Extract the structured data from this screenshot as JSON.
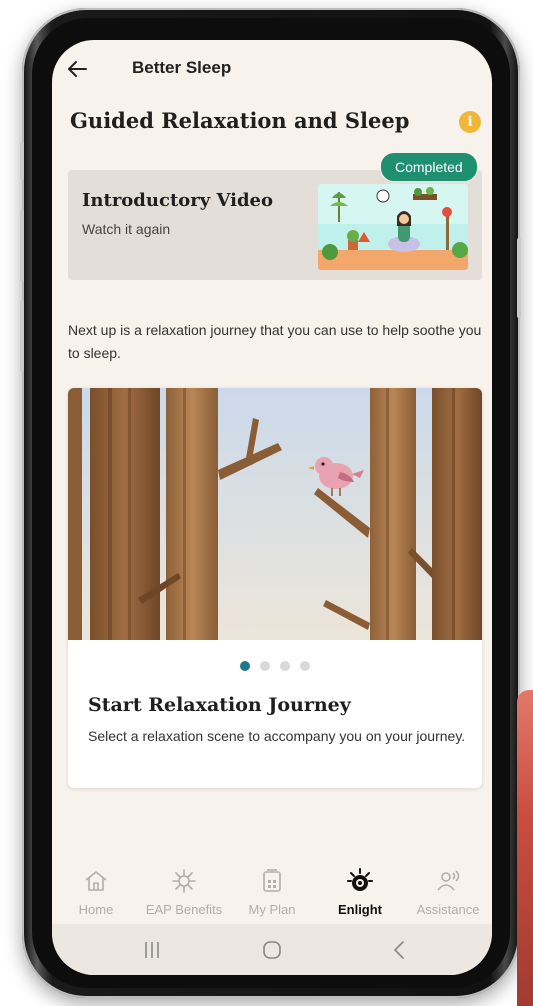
{
  "header": {
    "back_label": "Back",
    "title": "Better Sleep"
  },
  "page": {
    "title": "Guided Relaxation and Sleep",
    "info_icon": "i"
  },
  "intro_card": {
    "title": "Introductory Video",
    "subtitle": "Watch it again",
    "badge": "Completed",
    "thumbnail": "meditation-illustration"
  },
  "next_text": "Next up is a relaxation journey that you can use to help soothe you to sleep.",
  "journey": {
    "image": "forest-bird-illustration",
    "carousel_count": 4,
    "carousel_active": 1,
    "title": "Start Relaxation Journey",
    "description": "Select a relaxation scene to accompany you on your journey."
  },
  "bottom_nav": [
    {
      "label": "Home",
      "icon": "home-icon",
      "active": false
    },
    {
      "label": "EAP Benefits",
      "icon": "burst-icon",
      "active": false
    },
    {
      "label": "My Plan",
      "icon": "calendar-icon",
      "active": false
    },
    {
      "label": "Enlight",
      "icon": "enlight-icon",
      "active": true
    },
    {
      "label": "Assistance",
      "icon": "assistance-icon",
      "active": false
    }
  ],
  "colors": {
    "background": "#f7f3ec",
    "accent_green": "#1e8f6f",
    "accent_teal": "#1d7a8c",
    "info_orange": "#f0b63a"
  }
}
